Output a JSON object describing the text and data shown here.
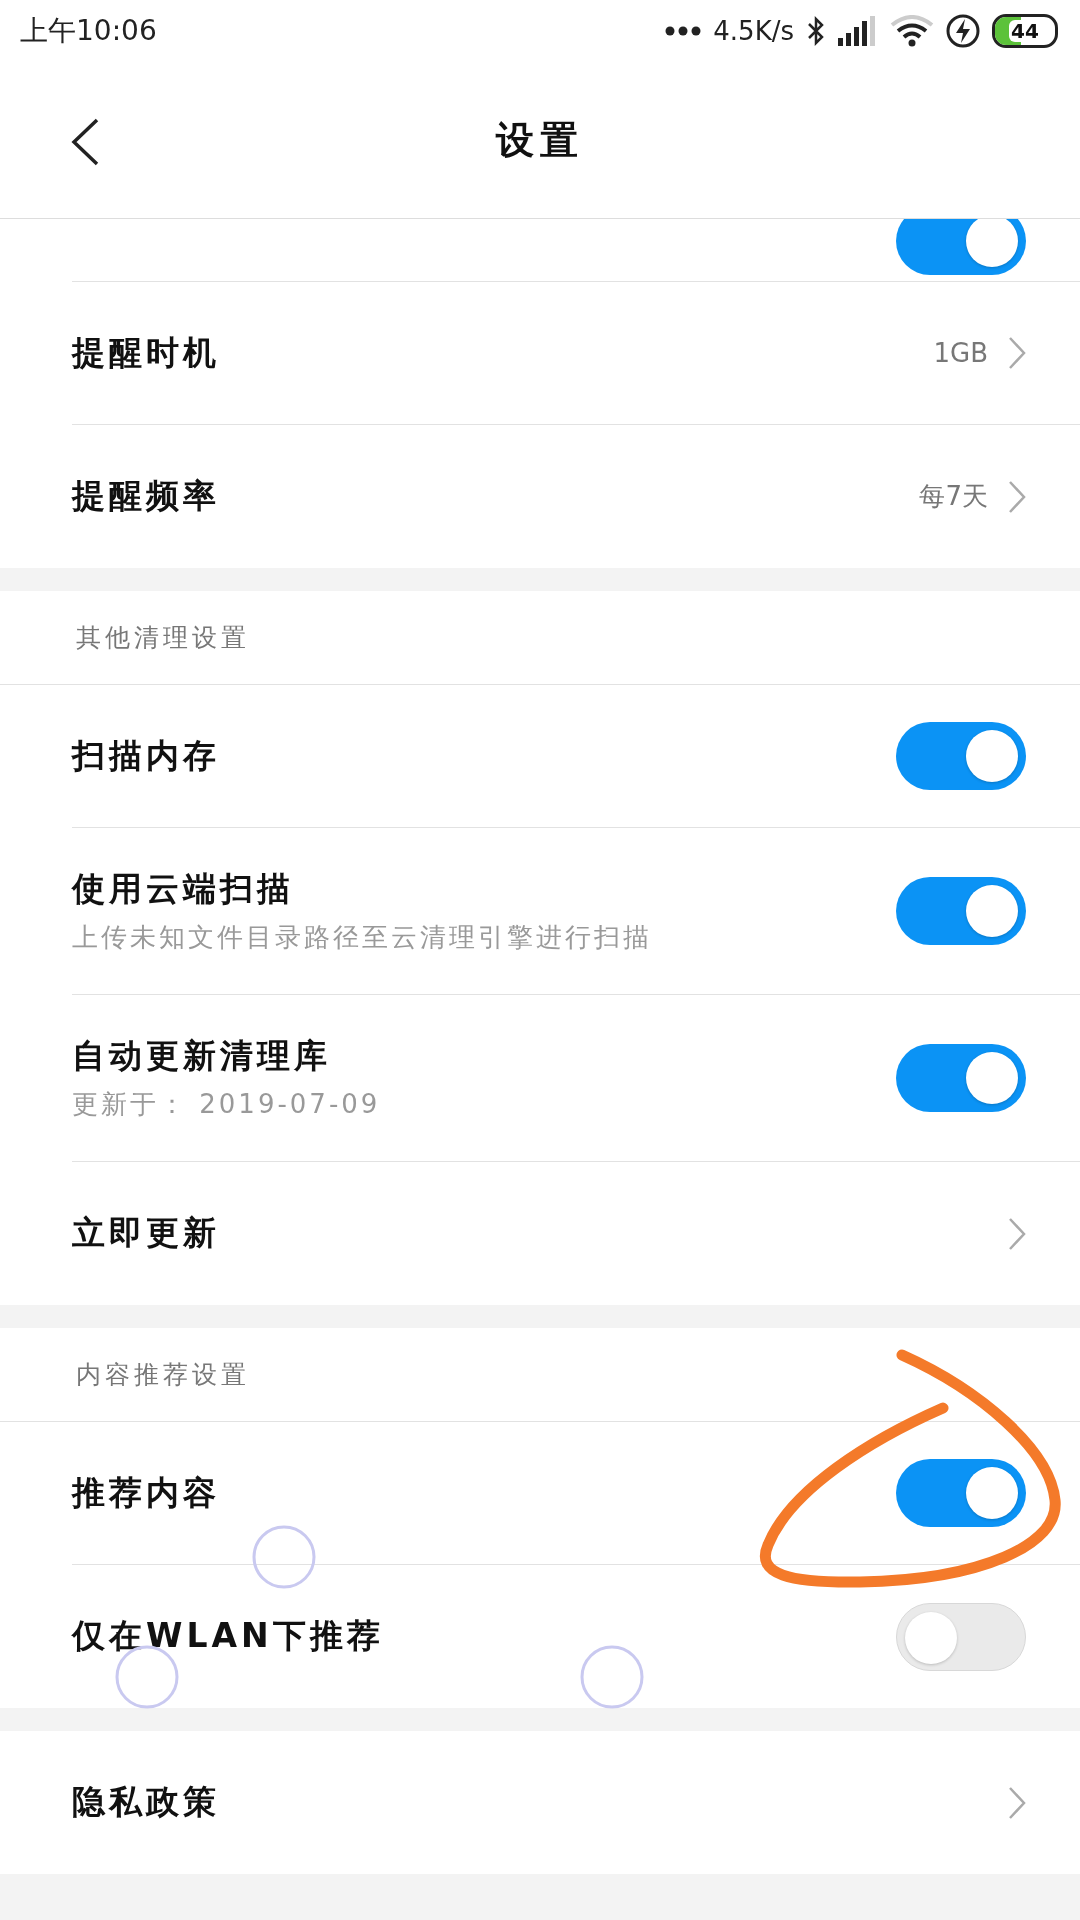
{
  "status_bar": {
    "time": "上午10:06",
    "net_speed": "4.5K/s",
    "battery": "44"
  },
  "header": {
    "title": "设置"
  },
  "sections": [
    {
      "rows": [
        {
          "kind": "cut_toggle",
          "on": true
        },
        {
          "kind": "value",
          "title": "提醒时机",
          "value": "1GB"
        },
        {
          "kind": "value",
          "title": "提醒频率",
          "value": "每7天"
        }
      ]
    },
    {
      "heading": "其他清理设置",
      "rows": [
        {
          "kind": "toggle",
          "title": "扫描内存",
          "on": true
        },
        {
          "kind": "toggle",
          "title": "使用云端扫描",
          "subtitle": "上传未知文件目录路径至云清理引擎进行扫描",
          "on": true
        },
        {
          "kind": "toggle",
          "title": "自动更新清理库",
          "subtitle": "更新于： 2019-07-09",
          "on": true
        },
        {
          "kind": "link",
          "title": "立即更新"
        }
      ]
    },
    {
      "heading": "内容推荐设置",
      "rows": [
        {
          "kind": "toggle",
          "title": "推荐内容",
          "on": true
        },
        {
          "kind": "toggle",
          "title": "仅在WLAN下推荐",
          "on": false
        }
      ]
    },
    {
      "rows": [
        {
          "kind": "link",
          "title": "隐私政策"
        }
      ]
    }
  ]
}
